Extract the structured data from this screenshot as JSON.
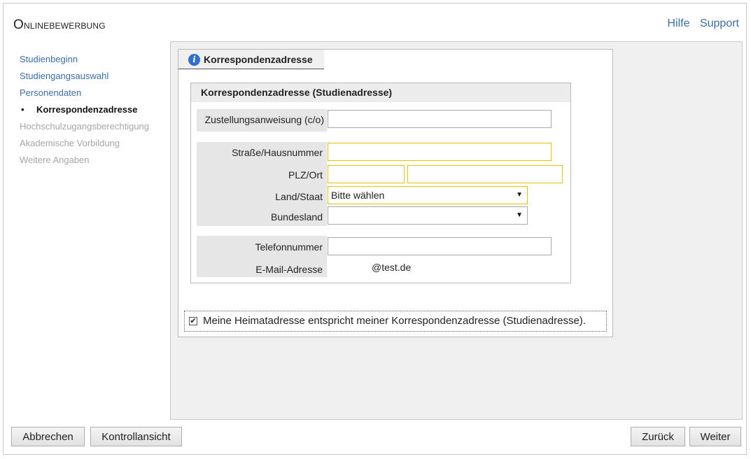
{
  "header": {
    "title_initial": "O",
    "title_rest": "nlinebewerbung",
    "links": {
      "help": "Hilfe",
      "support": "Support"
    }
  },
  "nav": {
    "items": [
      {
        "label": "Studienbeginn",
        "state": "link"
      },
      {
        "label": "Studiengangsauswahl",
        "state": "link"
      },
      {
        "label": "Personendaten",
        "state": "link"
      },
      {
        "label": "Korrespondenzadresse",
        "state": "active"
      },
      {
        "label": "Hochschulzugangsberechtigung",
        "state": "disabled"
      },
      {
        "label": "Akademische Vorbildung",
        "state": "disabled"
      },
      {
        "label": "Weitere Angaben",
        "state": "disabled"
      }
    ],
    "bullet": "•"
  },
  "tab": {
    "label": "Korrespondenzadresse",
    "icon": "info-icon",
    "icon_glyph": "i"
  },
  "form": {
    "section_title": "Korrespondenzadresse (Studienadresse)",
    "co_label": "Zustellungsanweisung (c/o)",
    "street_label": "Straße/Hausnummer",
    "zip_city_label": "PLZ/Ort",
    "country_label": "Land/Staat",
    "country_value": "Bitte wählen",
    "state_label": "Bundesland",
    "state_value": "",
    "phone_label": "Telefonnummer",
    "email_label": "E-Mail-Adresse",
    "email_value": "@test.de",
    "select_arrow": "▼"
  },
  "checkbox": {
    "label": "Meine Heimatadresse entspricht meiner Korrespondenzadresse (Studienadresse).",
    "checked": true,
    "mark": "✔"
  },
  "buttons": {
    "cancel": "Abbrechen",
    "review": "Kontrollansicht",
    "back": "Zurück",
    "next": "Weiter"
  },
  "colors": {
    "link": "#3b6ea8",
    "required_border": "#e6c200",
    "info_icon": "#2e6fcf"
  }
}
